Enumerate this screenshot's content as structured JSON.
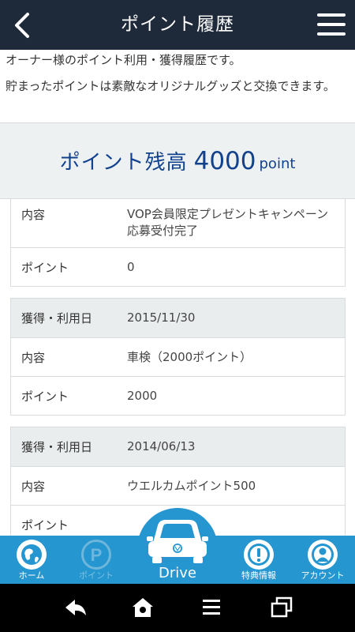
{
  "header": {
    "title": "ポイント履歴",
    "back_icon": "chevron-left-icon",
    "menu_icon": "hamburger-menu-icon"
  },
  "intro": {
    "line1": "オーナー様のポイント利用・獲得履歴です。",
    "line2": "貯まったポイントは素敵なオリジナルグッズと交換できます。"
  },
  "balance": {
    "label": "ポイント残高",
    "value": "4000",
    "unit": "point"
  },
  "records": [
    {
      "rows": [
        {
          "key": "内容",
          "value": "VOP会員限定プレゼントキャンペーン応募受付完了"
        },
        {
          "key": "ポイント",
          "value": "0"
        }
      ]
    },
    {
      "rows": [
        {
          "key": "獲得・利用日",
          "value": "2015/11/30"
        },
        {
          "key": "内容",
          "value": "車検（2000ポイント）"
        },
        {
          "key": "ポイント",
          "value": "2000"
        }
      ]
    },
    {
      "rows": [
        {
          "key": "獲得・利用日",
          "value": "2014/06/13"
        },
        {
          "key": "内容",
          "value": "ウエルカムポイント500"
        },
        {
          "key": "ポイント",
          "value": ""
        }
      ]
    }
  ],
  "tabbar": {
    "home": "ホーム",
    "point": "ポイント",
    "drive": "Drive",
    "benefits": "特典情報",
    "account": "アカウント"
  },
  "colors": {
    "header_bg": "#1e2a3a",
    "accent_blue": "#2596cf",
    "balance_text": "#12428e",
    "balance_bg": "#eef1f2"
  }
}
